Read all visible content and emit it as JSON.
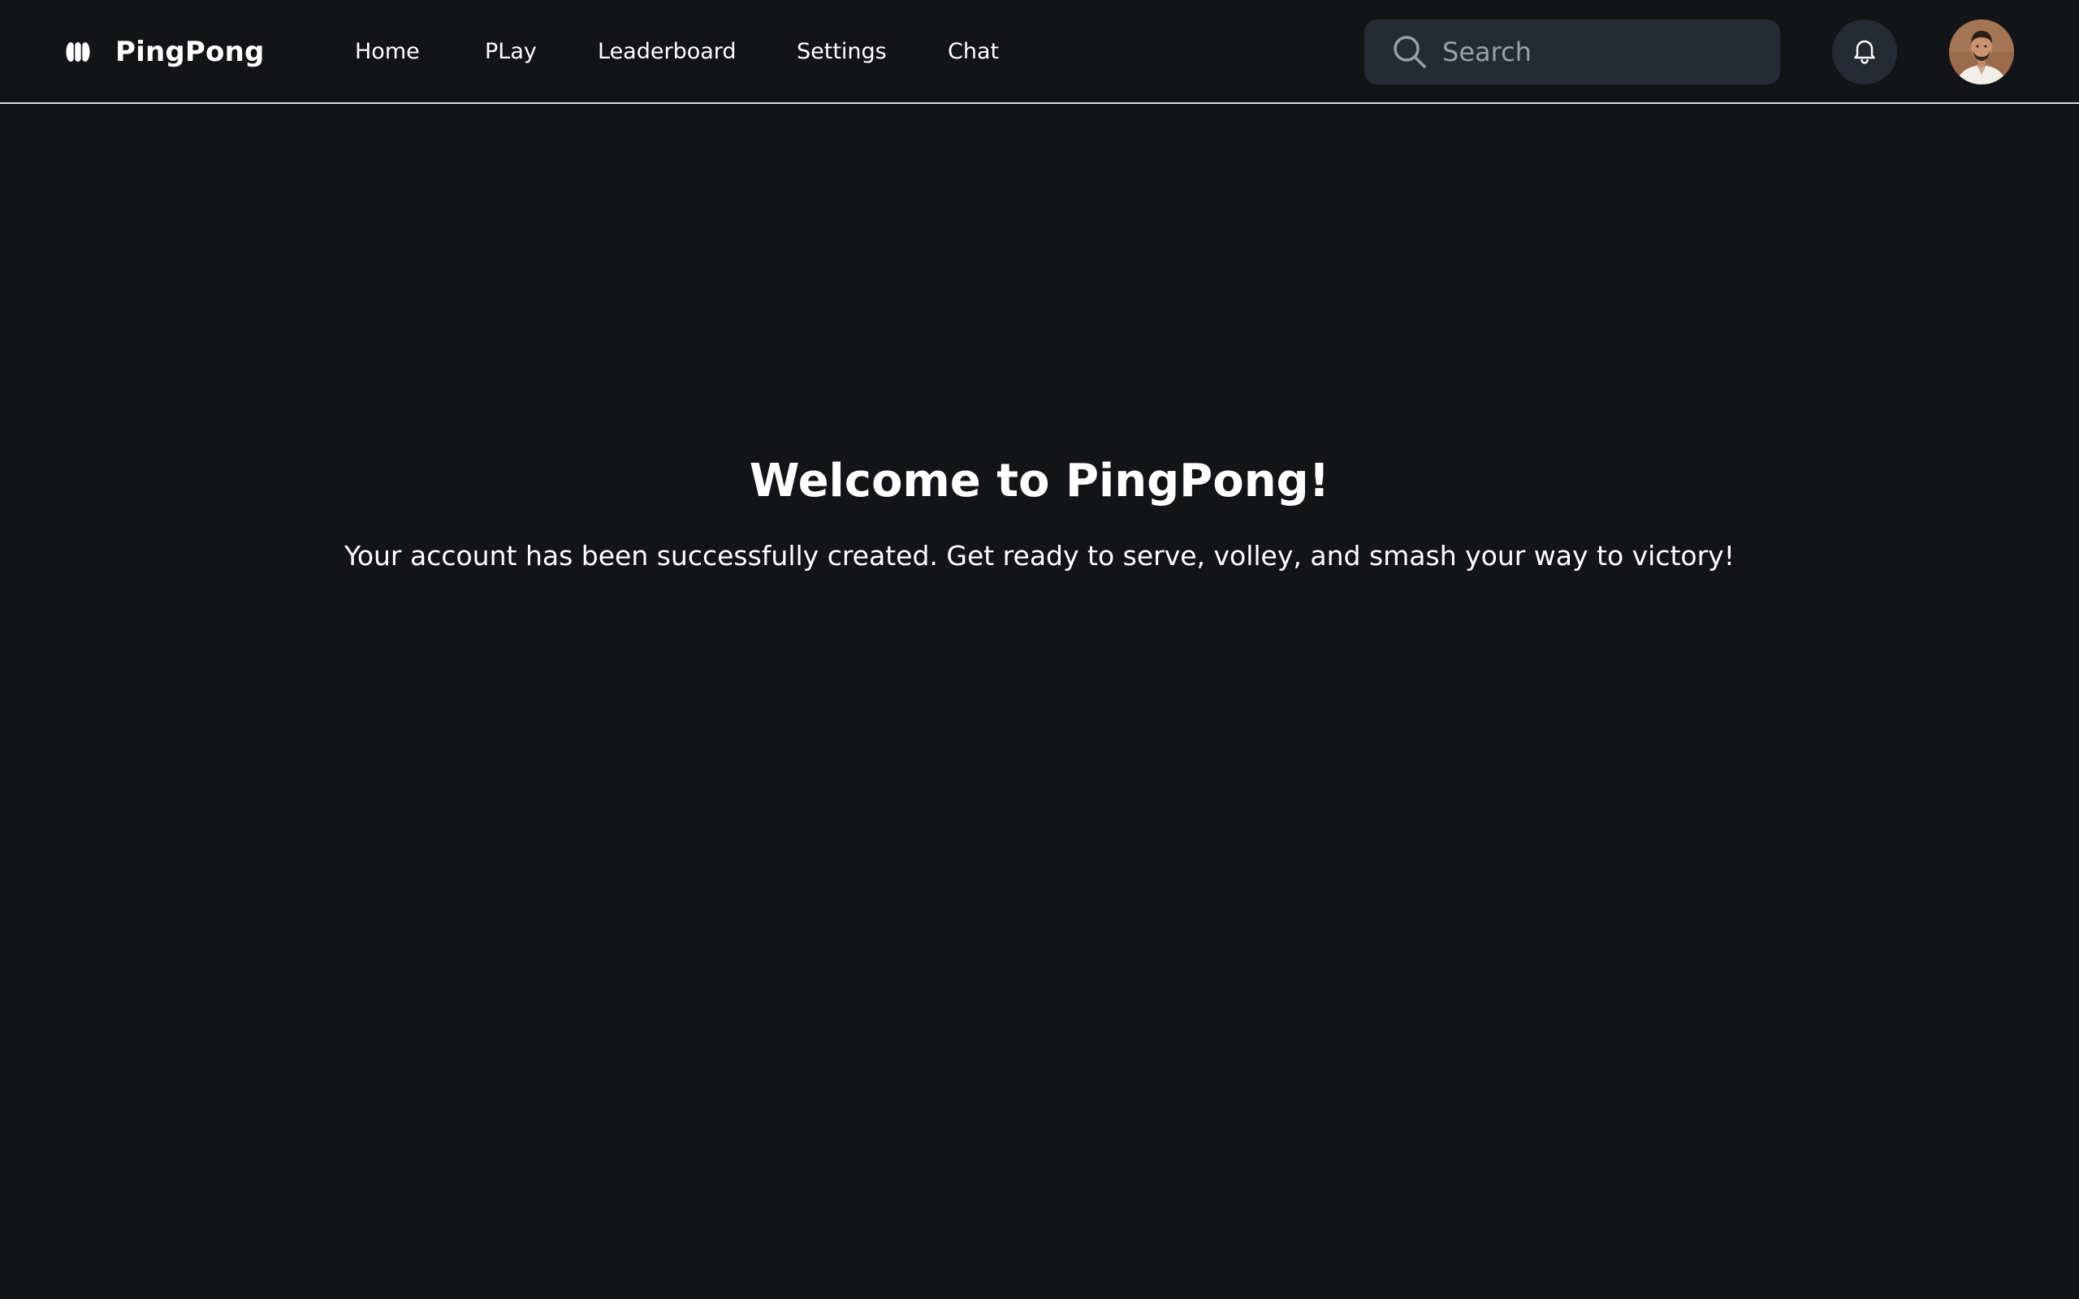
{
  "brand": {
    "name": "PingPong",
    "logo_icon": "pingpong-logo-icon"
  },
  "nav": {
    "items": [
      {
        "label": "Home"
      },
      {
        "label": "PLay"
      },
      {
        "label": "Leaderboard"
      },
      {
        "label": "Settings"
      },
      {
        "label": "Chat"
      }
    ]
  },
  "search": {
    "placeholder": "Search",
    "value": "",
    "icon": "search-icon"
  },
  "notifications": {
    "icon": "bell-icon"
  },
  "user": {
    "avatar_icon": "user-avatar"
  },
  "main": {
    "title": "Welcome to PingPong!",
    "subtitle": "Your account has been successfully created. Get ready to serve, volley, and smash your way to victory!"
  },
  "colors": {
    "background": "#131418",
    "surface": "#262b33",
    "text": "#ffffff",
    "muted_text": "#9aa0aa",
    "divider": "#d9dbe0"
  }
}
